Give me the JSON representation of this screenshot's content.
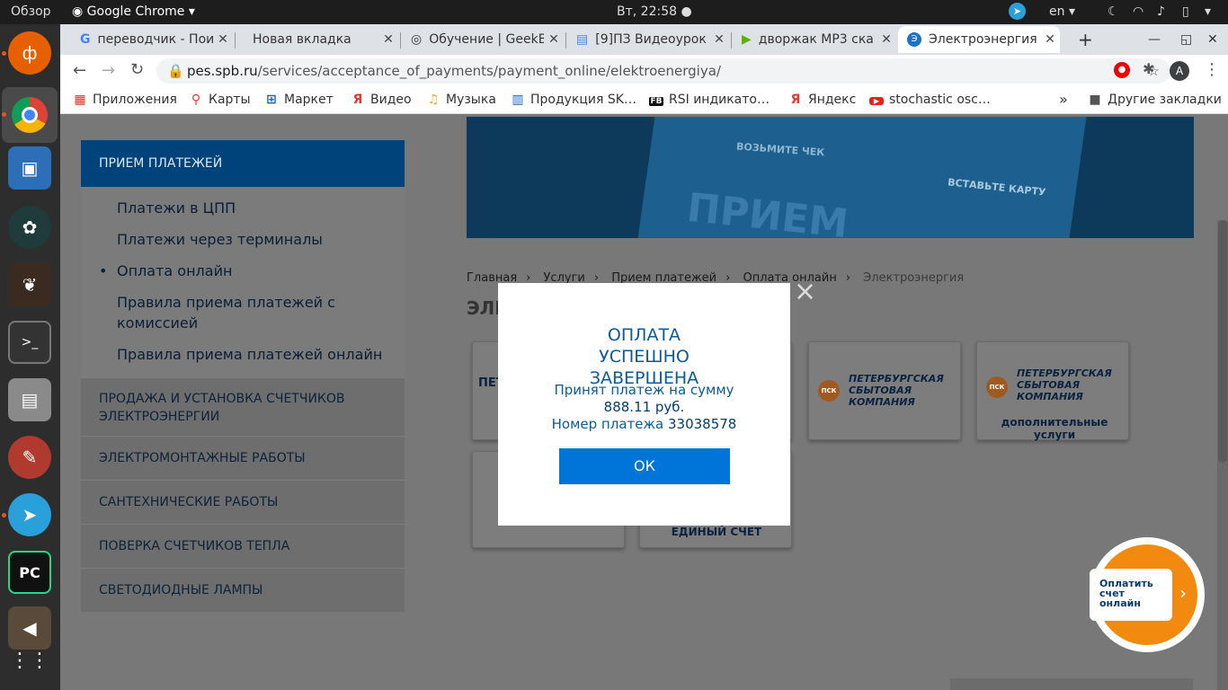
{
  "system": {
    "overview": "Обзор",
    "app": "Google Chrome",
    "clock": "Вт, 22:58",
    "lang": "en"
  },
  "tabs": [
    {
      "title": "переводчик - Пои",
      "icon": "G"
    },
    {
      "title": "Новая вкладка",
      "icon": ""
    },
    {
      "title": "Обучение | GeekB",
      "icon": "◎"
    },
    {
      "title": "[9]ПЗ Видеоурок",
      "icon": "▤"
    },
    {
      "title": "дворжак MP3 ска",
      "icon": "▶"
    },
    {
      "title": "Электроэнергия",
      "icon": "Э"
    }
  ],
  "address": {
    "host": "pes.spb.ru",
    "path": "/services/acceptance_of_payments/payment_online/elektroenergiya/"
  },
  "bookmarks": [
    {
      "label": "Приложения",
      "icon": "▦",
      "color": "#d93025"
    },
    {
      "label": "Карты",
      "icon": "⚲",
      "color": "#e53935"
    },
    {
      "label": "Маркет",
      "icon": "⊞",
      "color": "#1565c0"
    },
    {
      "label": "Видео",
      "icon": "Я",
      "color": "#e53935"
    },
    {
      "label": "Музыка",
      "icon": "♫",
      "color": "#f5a623"
    },
    {
      "label": "Продукция SK…",
      "icon": "▥",
      "color": "#1565c0"
    },
    {
      "label": "RSI индикато…",
      "icon": "FB",
      "color": "#111"
    },
    {
      "label": "Яндекс",
      "icon": "Я",
      "color": "#e53935"
    },
    {
      "label": "stochastic osc…",
      "icon": "▶",
      "color": "#e62117"
    }
  ],
  "bookmarks_more": "»",
  "other_bookmarks": "Другие закладки",
  "sidebar": {
    "header": "ПРИЕМ ПЛАТЕЖЕЙ",
    "subitems": [
      "Платежи в ЦПП",
      "Платежи через терминалы",
      "Оплата онлайн",
      "Правила приема платежей с комиссией",
      "Правила приема платежей онлайн"
    ],
    "sections": [
      "ПРОДАЖА И УСТАНОВКА СЧЕТЧИКОВ ЭЛЕКТРОЭНЕРГИИ",
      "ЭЛЕКТРОМОНТАЖНЫЕ РАБОТЫ",
      "САНТЕХНИЧЕСКИЕ РАБОТЫ",
      "ПОВЕРКА СЧЕТЧИКОВ ТЕПЛА",
      "СВЕТОДИОДНЫЕ ЛАМПЫ"
    ]
  },
  "banner": {
    "line1": "ВОЗЬМИТЕ ЧЕК",
    "line2": "ВСТАВЬТЕ КАРТУ",
    "big": "ПРИЕМ"
  },
  "breadcrumb": [
    "Главная",
    "Услуги",
    "Прием платежей",
    "Оплата онлайн",
    "Электроэнергия"
  ],
  "page_title": "ЭЛЕ",
  "cards": {
    "partial": "ПЕТ",
    "logo_text": "ПЕТЕРБУРГСКАЯ СБЫТОВАЯ КОМПАНИЯ",
    "logo_abbr": "ПСК",
    "extra": "дополнительные услуги",
    "single": "ЕДИНЫЙ СЧЕТ"
  },
  "modal": {
    "title": "ОПЛАТА УСПЕШНО ЗАВЕРШЕНА",
    "line1": "Принят платеж на сумму",
    "amount": "888.11 руб.",
    "number_label": "Номер платежа",
    "number": "33038578",
    "ok": "ОК",
    "close": "×"
  },
  "pay_badge": {
    "l1": "Оплатить",
    "l2": "счет",
    "l3": "онлайн"
  }
}
